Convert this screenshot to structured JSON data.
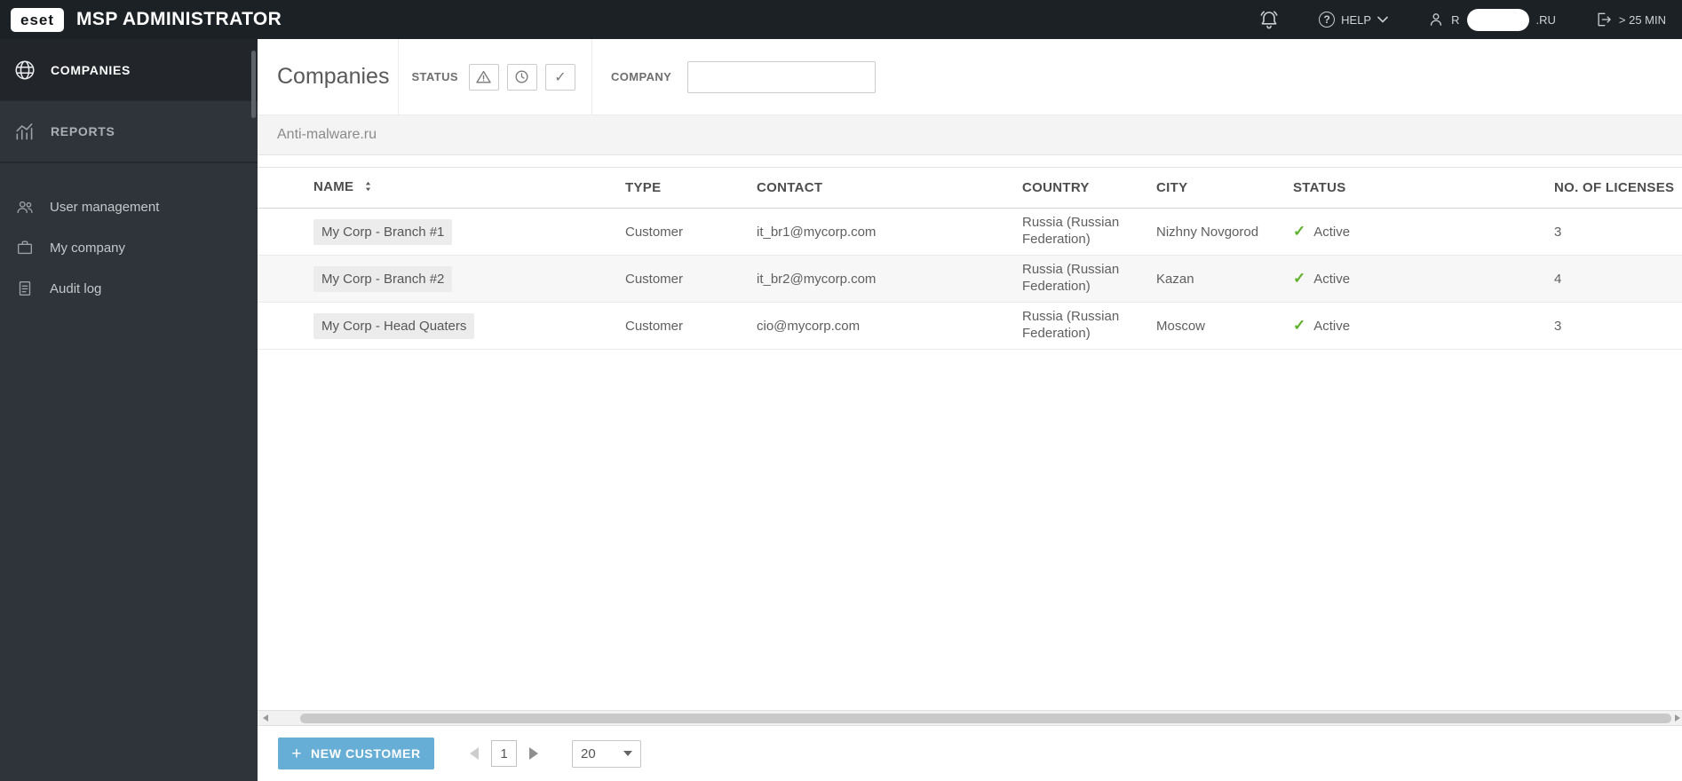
{
  "topbar": {
    "logo_text": "eset",
    "app_title": "MSP ADMINISTRATOR",
    "help_label": "HELP",
    "user_prefix": "R",
    "user_suffix": ".RU",
    "session_timeout": "> 25 MIN"
  },
  "icons": {
    "question_mark": "?",
    "plus": "+",
    "checkmark": "✓"
  },
  "sidebar": {
    "primary": [
      {
        "label": "COMPANIES",
        "active": true
      },
      {
        "label": "REPORTS",
        "active": false
      }
    ],
    "secondary": [
      {
        "label": "User management"
      },
      {
        "label": "My company"
      },
      {
        "label": "Audit log"
      }
    ]
  },
  "header": {
    "title": "Companies",
    "status_label": "STATUS",
    "company_label": "COMPANY",
    "company_filter_value": ""
  },
  "breadcrumb": {
    "text": "Anti-malware.ru"
  },
  "table": {
    "columns": [
      "NAME",
      "TYPE",
      "CONTACT",
      "COUNTRY",
      "CITY",
      "STATUS",
      "NO. OF LICENSES"
    ],
    "rows": [
      {
        "name": "My Corp - Branch #1",
        "type": "Customer",
        "contact": "it_br1@mycorp.com",
        "country": "Russia (Russian Federation)",
        "city": "Nizhny Novgorod",
        "status": "Active",
        "licenses": "3"
      },
      {
        "name": "My Corp - Branch #2",
        "type": "Customer",
        "contact": "it_br2@mycorp.com",
        "country": "Russia (Russian Federation)",
        "city": "Kazan",
        "status": "Active",
        "licenses": "4"
      },
      {
        "name": "My Corp - Head Quaters",
        "type": "Customer",
        "contact": "cio@mycorp.com",
        "country": "Russia (Russian Federation)",
        "city": "Moscow",
        "status": "Active",
        "licenses": "3"
      }
    ]
  },
  "footer": {
    "new_customer_label": "NEW CUSTOMER",
    "current_page": "1",
    "page_size": "20"
  },
  "colors": {
    "accent_blue": "#67aed6",
    "status_green": "#5fb12c",
    "topbar_bg": "#1c2126",
    "sidebar_bg": "#2f343a"
  }
}
